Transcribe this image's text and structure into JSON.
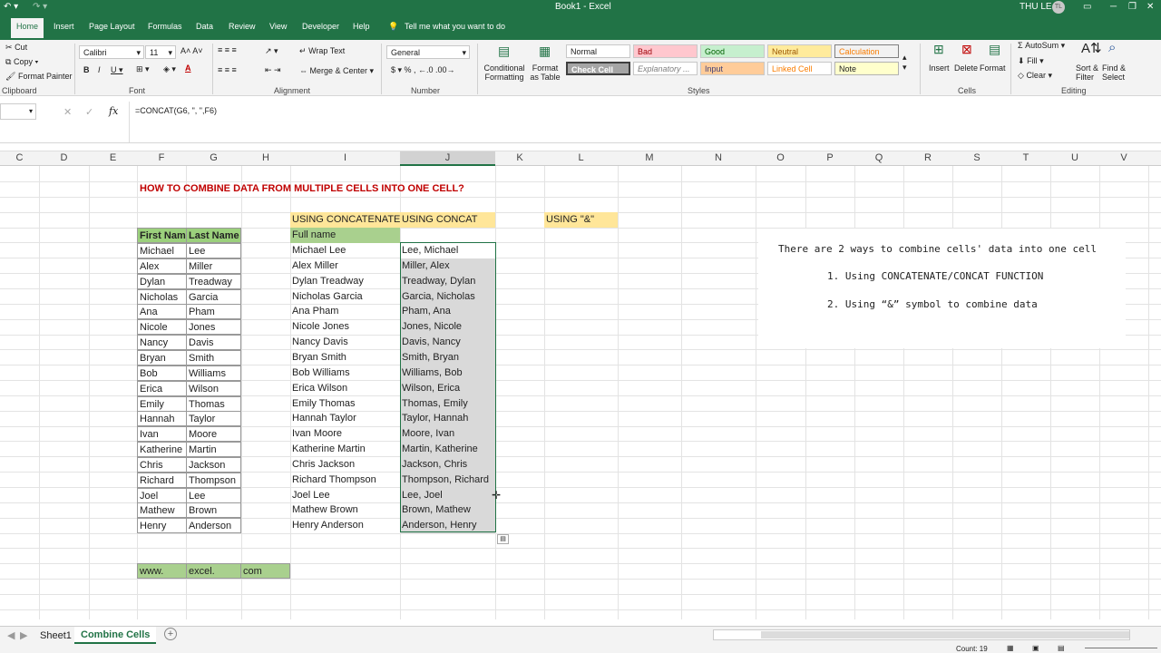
{
  "window": {
    "title": "Book1 - Excel",
    "user": "THU LE",
    "user_initials": "TL"
  },
  "tabs": [
    "File",
    "Home",
    "Insert",
    "Page Layout",
    "Formulas",
    "Data",
    "Review",
    "View",
    "Developer",
    "Help"
  ],
  "tell_me": "Tell me what you want to do",
  "ribbon": {
    "clipboard": {
      "cut": "Cut",
      "copy": "Copy",
      "format_painter": "Format Painter",
      "label": "Clipboard"
    },
    "font": {
      "name": "Calibri",
      "size": "11",
      "label": "Font"
    },
    "alignment": {
      "wrap": "Wrap Text",
      "merge": "Merge & Center",
      "label": "Alignment"
    },
    "number": {
      "format": "General",
      "label": "Number"
    },
    "styles": {
      "cond": "Conditional Formatting",
      "fmt_table": "Format as Table",
      "label": "Styles",
      "normal": "Normal",
      "bad": "Bad",
      "good": "Good",
      "neutral": "Neutral",
      "calculation": "Calculation",
      "check_cell": "Check Cell",
      "explanatory": "Explanatory ...",
      "input": "Input",
      "linked": "Linked Cell",
      "note": "Note"
    },
    "cells": {
      "insert": "Insert",
      "delete": "Delete",
      "format": "Format",
      "label": "Cells"
    },
    "editing": {
      "autosum": "AutoSum",
      "fill": "Fill",
      "clear": "Clear",
      "sort": "Sort & Filter",
      "find": "Find & Select",
      "label": "Editing"
    }
  },
  "formula_bar": {
    "formula": "=CONCAT(G6, \", \",F6)"
  },
  "columns": [
    "C",
    "D",
    "E",
    "F",
    "G",
    "H",
    "I",
    "J",
    "K",
    "L",
    "M",
    "N",
    "O",
    "P",
    "Q",
    "R",
    "S",
    "T",
    "U",
    "V"
  ],
  "sheet": {
    "heading": "HOW TO COMBINE DATA FROM MULTIPLE CELLS INTO ONE CELL?",
    "hdr_concatenate": "USING CONCATENATE",
    "hdr_concat": "USING CONCAT",
    "hdr_amp": "USING \"&\"",
    "first_name_hdr": "First Name",
    "last_name_hdr": "Last Name",
    "full_name_hdr": "Full name",
    "rows": [
      {
        "first": "Michael",
        "last": "Lee",
        "full": "Michael Lee",
        "concat": "Lee, Michael"
      },
      {
        "first": "Alex",
        "last": "Miller",
        "full": "Alex Miller",
        "concat": "Miller, Alex"
      },
      {
        "first": "Dylan",
        "last": "Treadway",
        "full": "Dylan Treadway",
        "concat": "Treadway, Dylan"
      },
      {
        "first": "Nicholas",
        "last": "Garcia",
        "full": "Nicholas Garcia",
        "concat": "Garcia, Nicholas"
      },
      {
        "first": "Ana",
        "last": "Pham",
        "full": "Ana Pham",
        "concat": "Pham, Ana"
      },
      {
        "first": "Nicole",
        "last": "Jones",
        "full": "Nicole Jones",
        "concat": "Jones, Nicole"
      },
      {
        "first": "Nancy",
        "last": "Davis",
        "full": "Nancy Davis",
        "concat": "Davis, Nancy"
      },
      {
        "first": "Bryan",
        "last": "Smith",
        "full": "Bryan Smith",
        "concat": "Smith, Bryan"
      },
      {
        "first": "Bob",
        "last": "Williams",
        "full": "Bob Williams",
        "concat": "Williams, Bob"
      },
      {
        "first": "Erica",
        "last": "Wilson",
        "full": "Erica Wilson",
        "concat": "Wilson, Erica"
      },
      {
        "first": "Emily",
        "last": "Thomas",
        "full": "Emily Thomas",
        "concat": "Thomas, Emily"
      },
      {
        "first": "Hannah",
        "last": "Taylor",
        "full": "Hannah Taylor",
        "concat": "Taylor, Hannah"
      },
      {
        "first": "Ivan",
        "last": "Moore",
        "full": "Ivan Moore",
        "concat": "Moore, Ivan"
      },
      {
        "first": "Katherine",
        "last": "Martin",
        "full": "Katherine Martin",
        "concat": "Martin, Katherine"
      },
      {
        "first": "Chris",
        "last": "Jackson",
        "full": "Chris Jackson",
        "concat": "Jackson, Chris"
      },
      {
        "first": "Richard",
        "last": "Thompson",
        "full": "Richard Thompson",
        "concat": "Thompson, Richard"
      },
      {
        "first": "Joel",
        "last": "Lee",
        "full": "Joel Lee",
        "concat": "Lee, Joel"
      },
      {
        "first": "Mathew",
        "last": "Brown",
        "full": "Mathew Brown",
        "concat": "Brown, Mathew"
      },
      {
        "first": "Henry",
        "last": "Anderson",
        "full": "Henry Anderson",
        "concat": "Anderson, Henry"
      }
    ],
    "url_parts": [
      "www.",
      "excel.",
      "com"
    ]
  },
  "note": {
    "line1": "There are 2 ways to combine cells' data into one cell",
    "line2": "1. Using CONCATENATE/CONCAT FUNCTION",
    "line3": "2. Using “&” symbol to combine data"
  },
  "sheets": [
    "Sheet1",
    "Combine Cells"
  ],
  "status": {
    "count": "Count: 19"
  },
  "colors": {
    "excel_green": "#217346",
    "header_fill": "#9bd07c",
    "concat_fill": "#ffe699",
    "heading_red": "#c00000"
  }
}
